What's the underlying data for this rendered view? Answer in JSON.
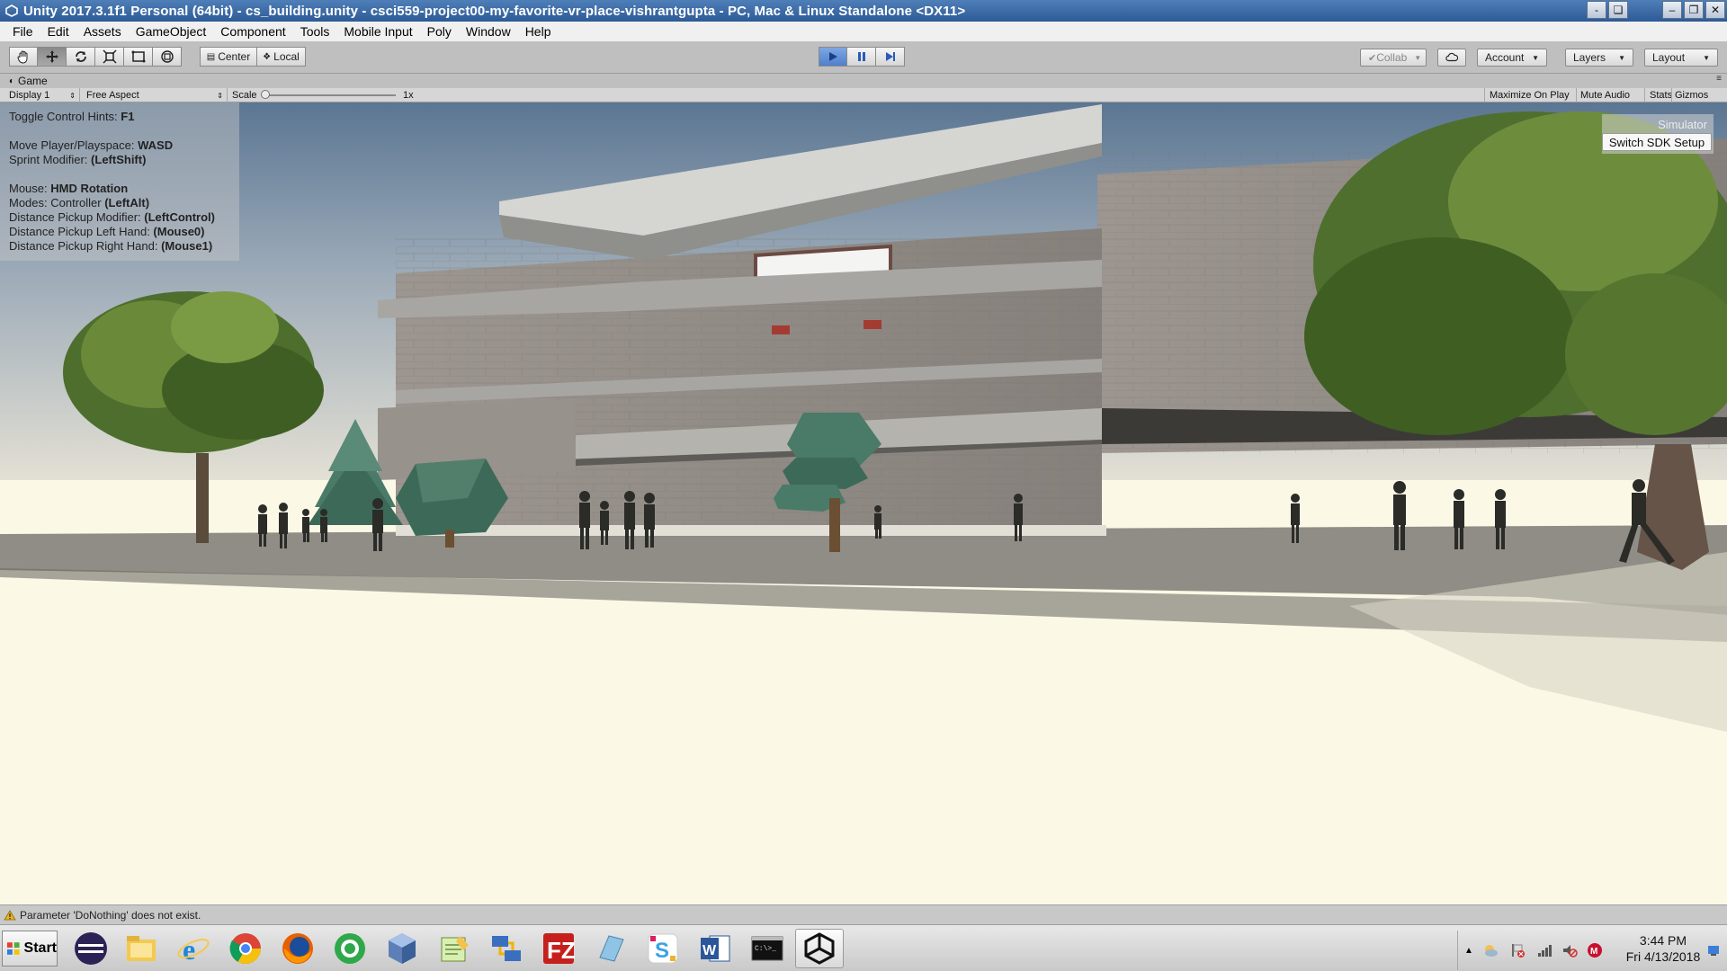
{
  "window": {
    "title": "Unity 2017.3.1f1 Personal (64bit) - cs_building.unity - csci559-project00-my-favorite-vr-place-vishrantgupta - PC, Mac & Linux Standalone <DX11>"
  },
  "menu": [
    "File",
    "Edit",
    "Assets",
    "GameObject",
    "Component",
    "Tools",
    "Mobile Input",
    "Poly",
    "Window",
    "Help"
  ],
  "toolbar": {
    "tools": [
      "hand-icon",
      "move-icon",
      "rotate-icon",
      "scale-icon",
      "rect-icon",
      "transform-icon"
    ],
    "pivot_center": "Center",
    "pivot_local": "Local",
    "collab": "Collab",
    "account": "Account",
    "layers": "Layers",
    "layout": "Layout"
  },
  "game_tab": {
    "label": "Game",
    "display": "Display 1",
    "aspect": "Free Aspect",
    "scale_label": "Scale",
    "scale_value": "1x",
    "maximize": "Maximize On Play",
    "mute": "Mute Audio",
    "stats": "Stats",
    "gizmos": "Gizmos"
  },
  "hints": {
    "toggle_prefix": "Toggle Control Hints: ",
    "toggle_key": "F1",
    "move_prefix": "Move Player/Playspace: ",
    "move_key": "WASD",
    "sprint_prefix": "Sprint Modifier: ",
    "sprint_key": "(LeftShift)",
    "mouse_prefix": "Mouse: ",
    "mouse_key": "HMD Rotation",
    "modes_prefix": "Modes: Controller ",
    "modes_key": "(LeftAlt)",
    "dist_mod_prefix": "Distance Pickup Modifier: ",
    "dist_mod_key": "(LeftControl)",
    "dist_left_prefix": "Distance Pickup Left Hand: ",
    "dist_left_key": "(Mouse0)",
    "dist_right_prefix": "Distance Pickup Right Hand: ",
    "dist_right_key": "(Mouse1)"
  },
  "simulator_label": "Simulator",
  "sdk_button": "Switch SDK Setup",
  "status": {
    "message": "Parameter 'DoNothing' does not exist."
  },
  "taskbar": {
    "start": "Start",
    "apps": [
      "eclipse-icon",
      "file-explorer-icon",
      "internet-explorer-icon",
      "chrome-icon",
      "firefox-icon",
      "green-circle-app-icon",
      "virtualbox-icon",
      "notepad-icon",
      "network-icon",
      "filezilla-icon",
      "generic-app-icon",
      "slack-icon",
      "word-icon",
      "terminal-icon",
      "unity-icon"
    ],
    "time": "3:44 PM",
    "date": "Fri 4/13/2018"
  },
  "colors": {
    "titlebar": "#2c5a96",
    "play_active": "#4f80cc",
    "ground": "#fbf8e6"
  }
}
